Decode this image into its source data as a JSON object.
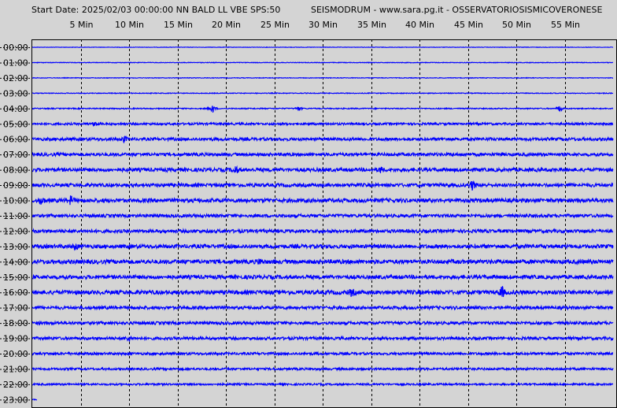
{
  "header": {
    "left": "Start Date: 2025/02/03 00:00:00 NN BALD LL VBE SPS:50",
    "right": "SEISMODRUM - www.sara.pg.it - OSSERVATORIOSISMICOVERONESE"
  },
  "chart_data": {
    "type": "line",
    "title": "",
    "x_tick_labels": [
      "5 Min",
      "10 Min",
      "15 Min",
      "20 Min",
      "25 Min",
      "30 Min",
      "35 Min",
      "40 Min",
      "45 Min",
      "50 Min",
      "55 Min"
    ],
    "x_tick_minutes": [
      5,
      10,
      15,
      20,
      25,
      30,
      35,
      40,
      45,
      50,
      55
    ],
    "xlim": [
      0,
      60
    ],
    "row_labels": [
      "00:00",
      "01:00",
      "02:00",
      "03:00",
      "04:00",
      "05:00",
      "06:00",
      "07:00",
      "08:00",
      "09:00",
      "10:00",
      "11:00",
      "12:00",
      "13:00",
      "14:00",
      "15:00",
      "16:00",
      "17:00",
      "18:00",
      "19:00",
      "20:00",
      "21:00",
      "22:00",
      "23:00"
    ],
    "rows_with_trace": 23,
    "partial_last_row_minutes": 0.5,
    "noise_level": [
      0.3,
      0.4,
      0.4,
      0.5,
      0.7,
      1.4,
      1.9,
      2.0,
      2.3,
      2.2,
      2.5,
      2.0,
      2.1,
      2.4,
      2.6,
      2.4,
      2.6,
      2.0,
      1.9,
      1.8,
      1.6,
      1.4,
      1.2,
      0.5
    ],
    "events": [
      {
        "row": 4,
        "minute": 18.6,
        "amplitude": 7
      },
      {
        "row": 4,
        "minute": 27.5,
        "amplitude": 3
      },
      {
        "row": 4,
        "minute": 54.5,
        "amplitude": 5
      },
      {
        "row": 5,
        "minute": 6.5,
        "amplitude": 4
      },
      {
        "row": 6,
        "minute": 9.5,
        "amplitude": 4
      },
      {
        "row": 8,
        "minute": 21.0,
        "amplitude": 6
      },
      {
        "row": 8,
        "minute": 36.0,
        "amplitude": 4
      },
      {
        "row": 9,
        "minute": 45.5,
        "amplitude": 7
      },
      {
        "row": 10,
        "minute": 1.0,
        "amplitude": 6
      },
      {
        "row": 10,
        "minute": 4.0,
        "amplitude": 6
      },
      {
        "row": 13,
        "minute": 4.5,
        "amplitude": 4
      },
      {
        "row": 14,
        "minute": 23.5,
        "amplitude": 4
      },
      {
        "row": 16,
        "minute": 33.0,
        "amplitude": 5
      },
      {
        "row": 16,
        "minute": 48.5,
        "amplitude": 9
      },
      {
        "row": 19,
        "minute": 10.0,
        "amplitude": 4
      }
    ],
    "trace_color": "#0000ff",
    "grid": true,
    "grid_style": "dashed"
  }
}
